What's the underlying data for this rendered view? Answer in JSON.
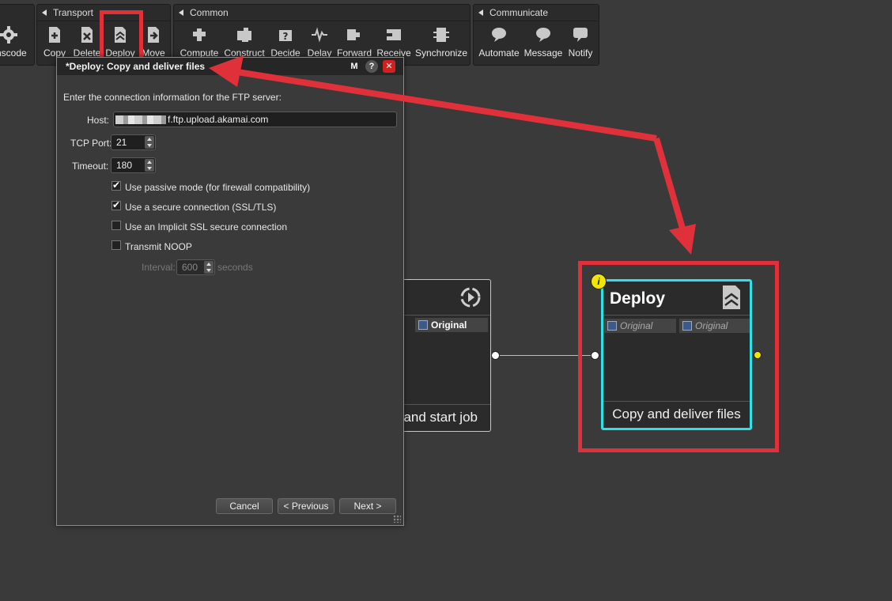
{
  "toolbar": {
    "partial_left": {
      "label": "nscode"
    },
    "transport": {
      "title": "Transport",
      "items": [
        {
          "label": "Copy"
        },
        {
          "label": "Delete"
        },
        {
          "label": "Deploy"
        },
        {
          "label": "Move"
        }
      ]
    },
    "common": {
      "title": "Common",
      "items": [
        {
          "label": "Compute"
        },
        {
          "label": "Construct"
        },
        {
          "label": "Decide"
        },
        {
          "label": "Delay"
        },
        {
          "label": "Forward"
        },
        {
          "label": "Receive"
        },
        {
          "label": "Synchronize"
        }
      ]
    },
    "communicate": {
      "title": "Communicate",
      "items": [
        {
          "label": "Automate"
        },
        {
          "label": "Message"
        },
        {
          "label": "Notify"
        }
      ]
    }
  },
  "dialog": {
    "title": "*Deploy: Copy and deliver files",
    "title_buttons": {
      "m": "M",
      "help": "?",
      "close": "✕"
    },
    "intro": "Enter the connection information for the FTP server:",
    "host_label": "Host:",
    "host_value": "f.ftp.upload.akamai.com",
    "tcp_port_label": "TCP Port:",
    "tcp_port_value": "21",
    "timeout_label": "Timeout:",
    "timeout_value": "180",
    "options": [
      {
        "label": "Use passive mode (for firewall compatibility)",
        "checked": true
      },
      {
        "label": "Use a secure connection (SSL/TLS)",
        "checked": true
      },
      {
        "label": "Use an Implicit SSL secure connection",
        "checked": false
      },
      {
        "label": "Transmit NOOP",
        "checked": false
      }
    ],
    "interval_label": "Interval:",
    "interval_value": "600",
    "interval_unit": "seconds",
    "buttons": {
      "cancel": "Cancel",
      "previous": "< Previous",
      "next": "Next >"
    }
  },
  "nodes": {
    "left_node": {
      "tag": "Original",
      "footer": "and start job"
    },
    "deploy_node": {
      "title": "Deploy",
      "tags": [
        "Original",
        "Original"
      ],
      "footer": "Copy and deliver files",
      "info_badge": "i"
    }
  },
  "colors": {
    "highlight_red": "#e0303a",
    "node_selected": "#2fe0e6",
    "info_yellow": "#f2e600"
  }
}
